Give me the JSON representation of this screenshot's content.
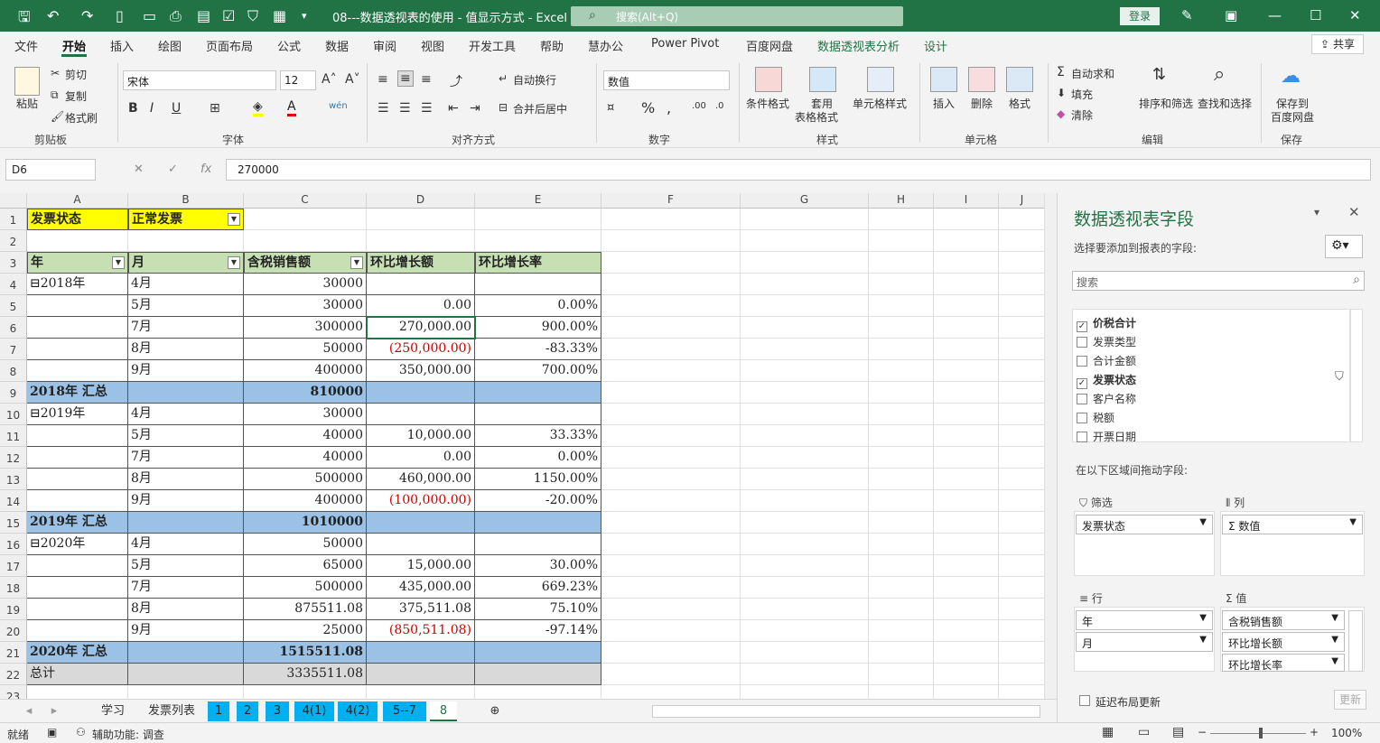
{
  "titlebar": {
    "doc_title": "08---数据透视表的使用 - 值显示方式  -  Excel",
    "search_placeholder": "搜索(Alt+Q)",
    "login": "登录"
  },
  "menu": {
    "tabs": [
      "文件",
      "开始",
      "插入",
      "绘图",
      "页面布局",
      "公式",
      "数据",
      "审阅",
      "视图",
      "开发工具",
      "帮助",
      "慧办公",
      "Power Pivot",
      "百度网盘",
      "数据透视表分析",
      "设计"
    ],
    "share": "共享"
  },
  "ribbon": {
    "clipboard": {
      "paste": "粘贴",
      "cut": "剪切",
      "copy": "复制",
      "format_painter": "格式刷",
      "group": "剪贴板"
    },
    "font": {
      "name": "宋体",
      "size": "12",
      "bold": "B",
      "italic": "I",
      "underline": "U",
      "group": "字体"
    },
    "alignment": {
      "wrap": "自动换行",
      "merge": "合并后居中",
      "group": "对齐方式"
    },
    "number": {
      "format": "数值",
      "group": "数字"
    },
    "styles": {
      "conditional": "条件格式",
      "table_line1": "套用",
      "table_line2": "表格格式",
      "cell_styles": "单元格样式",
      "group": "样式"
    },
    "cells": {
      "insert": "插入",
      "delete": "删除",
      "format": "格式",
      "group": "单元格"
    },
    "editing": {
      "autosum": "自动求和",
      "fill": "填充",
      "clear": "清除",
      "sort_filter": "排序和筛选",
      "find_select": "查找和选择",
      "group": "编辑"
    },
    "save": {
      "line1": "保存到",
      "line2": "百度网盘",
      "group": "保存"
    }
  },
  "formula_bar": {
    "name_box": "D6",
    "formula": "270000"
  },
  "sheet": {
    "columns": [
      "A",
      "B",
      "C",
      "D",
      "E",
      "F",
      "G",
      "H",
      "I",
      "J"
    ],
    "filter": {
      "label": "发票状态",
      "value": "正常发票"
    },
    "headers": [
      "年",
      "月",
      "含税销售额",
      "环比增长额",
      "环比增长率"
    ],
    "rows": [
      {
        "year": "⊟2018年",
        "month": "4月",
        "amount": "30000",
        "diff": "",
        "rate": ""
      },
      {
        "year": "",
        "month": "5月",
        "amount": "30000",
        "diff": "0.00",
        "rate": "0.00%"
      },
      {
        "year": "",
        "month": "7月",
        "amount": "300000",
        "diff": "270,000.00",
        "rate": "900.00%"
      },
      {
        "year": "",
        "month": "8月",
        "amount": "50000",
        "diff": "(250,000.00)",
        "rate": "-83.33%",
        "neg": true
      },
      {
        "year": "",
        "month": "9月",
        "amount": "400000",
        "diff": "350,000.00",
        "rate": "700.00%"
      },
      {
        "subtotal": true,
        "year": "2018年 汇总",
        "amount": "810000"
      },
      {
        "year": "⊟2019年",
        "month": "4月",
        "amount": "30000",
        "diff": "",
        "rate": ""
      },
      {
        "year": "",
        "month": "5月",
        "amount": "40000",
        "diff": "10,000.00",
        "rate": "33.33%"
      },
      {
        "year": "",
        "month": "7月",
        "amount": "40000",
        "diff": "0.00",
        "rate": "0.00%"
      },
      {
        "year": "",
        "month": "8月",
        "amount": "500000",
        "diff": "460,000.00",
        "rate": "1150.00%"
      },
      {
        "year": "",
        "month": "9月",
        "amount": "400000",
        "diff": "(100,000.00)",
        "rate": "-20.00%",
        "neg": true
      },
      {
        "subtotal": true,
        "year": "2019年 汇总",
        "amount": "1010000"
      },
      {
        "year": "⊟2020年",
        "month": "4月",
        "amount": "50000",
        "diff": "",
        "rate": ""
      },
      {
        "year": "",
        "month": "5月",
        "amount": "65000",
        "diff": "15,000.00",
        "rate": "30.00%"
      },
      {
        "year": "",
        "month": "7月",
        "amount": "500000",
        "diff": "435,000.00",
        "rate": "669.23%"
      },
      {
        "year": "",
        "month": "8月",
        "amount": "875511.08",
        "diff": "375,511.08",
        "rate": "75.10%"
      },
      {
        "year": "",
        "month": "9月",
        "amount": "25000",
        "diff": "(850,511.08)",
        "rate": "-97.14%",
        "neg": true
      },
      {
        "subtotal": true,
        "year": "2020年 汇总",
        "amount": "1515511.08"
      },
      {
        "total": true,
        "year": "总计",
        "amount": "3335511.08"
      }
    ],
    "row_numbers": [
      "1",
      "2",
      "3",
      "4",
      "5",
      "6",
      "7",
      "8",
      "9",
      "10",
      "11",
      "12",
      "13",
      "14",
      "15",
      "16",
      "17",
      "18",
      "19",
      "20",
      "21",
      "22",
      "23"
    ]
  },
  "sheet_tabs": [
    "学习",
    "发票列表",
    "1",
    "2",
    "3",
    "4(1)",
    "4(2)",
    "5--7",
    "8"
  ],
  "status": {
    "ready": "就绪",
    "accessibility": "辅助功能: 调查",
    "zoom": "100%"
  },
  "pivot_panel": {
    "title": "数据透视表字段",
    "subtitle": "选择要添加到报表的字段:",
    "search_placeholder": "搜索",
    "fields": [
      {
        "name": "价税合计",
        "checked": true
      },
      {
        "name": "发票类型",
        "checked": false
      },
      {
        "name": "合计金额",
        "checked": false
      },
      {
        "name": "发票状态",
        "checked": true
      },
      {
        "name": "客户名称",
        "checked": false
      },
      {
        "name": "税额",
        "checked": false
      },
      {
        "name": "开票日期",
        "checked": false
      }
    ],
    "drag_hint": "在以下区域间拖动字段:",
    "filters_label": "筛选",
    "columns_label": "列",
    "rows_label": "行",
    "values_label": "值",
    "filters": [
      "发票状态"
    ],
    "columns": [
      "Σ 数值"
    ],
    "rows": [
      "年",
      "月"
    ],
    "values": [
      "含税销售额",
      "环比增长额",
      "环比增长率"
    ],
    "defer": "延迟布局更新",
    "update": "更新"
  }
}
